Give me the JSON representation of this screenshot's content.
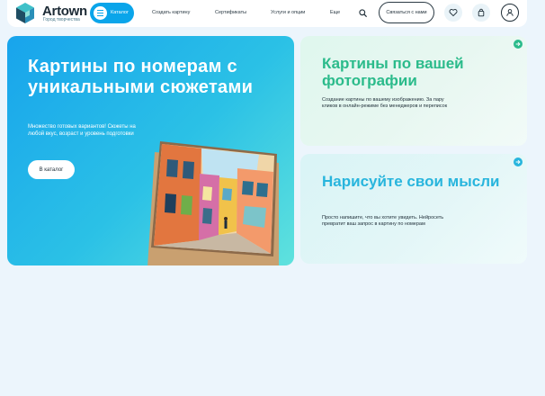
{
  "header": {
    "brand": "Artown",
    "tagline": "Город творчества",
    "catalog_label": "Каталог",
    "nav": [
      "Создать картину",
      "Сертификаты",
      "Услуги и опции",
      "Еще"
    ],
    "contact_label": "Связаться с нами"
  },
  "icons": {
    "logo": "cube-logo-icon",
    "catalog": "hamburger-menu-icon",
    "search": "search-icon",
    "favorites": "heart-icon",
    "cart": "shopping-bag-icon",
    "account": "user-icon",
    "card_arrow": "arrow-right-icon"
  },
  "hero": {
    "title": "Картины по номерам с уникальными сюжетами",
    "subtitle": "Множество готовых вариантов! Сюжеты на любой вкус, возраст и уровень подготовки",
    "cta": "В каталог"
  },
  "cards": [
    {
      "title": "Картины по вашей фотографии",
      "text": "Создание картины по вашему изображению. За пару кликов в онлайн-режиме без менеджеров и переписок",
      "accent": "#2bbb8b"
    },
    {
      "title": "Нарисуйте свои мысли",
      "text": "Просто напишите, что вы хотите увидеть. Нейросеть превратит ваш запрос в картину по номерам",
      "accent": "#28b5dd"
    }
  ],
  "colors": {
    "accent_blue": "#0aa5ea",
    "page_bg": "#ecf5fc",
    "text_dark": "#1e2d37"
  }
}
